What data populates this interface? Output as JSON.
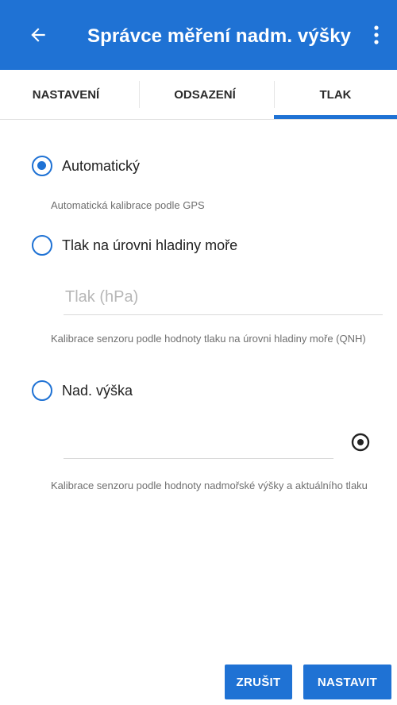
{
  "appbar": {
    "title": "Správce měření nadm. výšky",
    "back_icon": "arrow-left-icon",
    "menu_icon": "more-vert-icon"
  },
  "tabs": [
    {
      "label": "NASTAVENÍ",
      "selected": false
    },
    {
      "label": "ODSAZENÍ",
      "selected": false
    },
    {
      "label": "TLAK",
      "selected": true
    }
  ],
  "options": {
    "auto": {
      "label": "Automatický",
      "checked": true,
      "description": "Automatická kalibrace podle GPS"
    },
    "sea_level": {
      "label": "Tlak na úrovni hladiny moře",
      "checked": false,
      "input_placeholder": "Tlak (hPa)",
      "description": "Kalibrace senzoru podle hodnoty tlaku na úrovni hladiny moře (QNH)"
    },
    "altitude": {
      "label": "Nad. výška",
      "checked": false,
      "input_value": "",
      "locate_icon": "gps-fixed-icon",
      "description": "Kalibrace senzoru podle hodnoty nadmořské výšky a aktuálního tlaku"
    }
  },
  "actions": {
    "cancel_label": "ZRUŠIT",
    "ok_label": "NASTAVIT"
  },
  "colors": {
    "accent": "#1f72d4",
    "background": "#ffffff"
  }
}
